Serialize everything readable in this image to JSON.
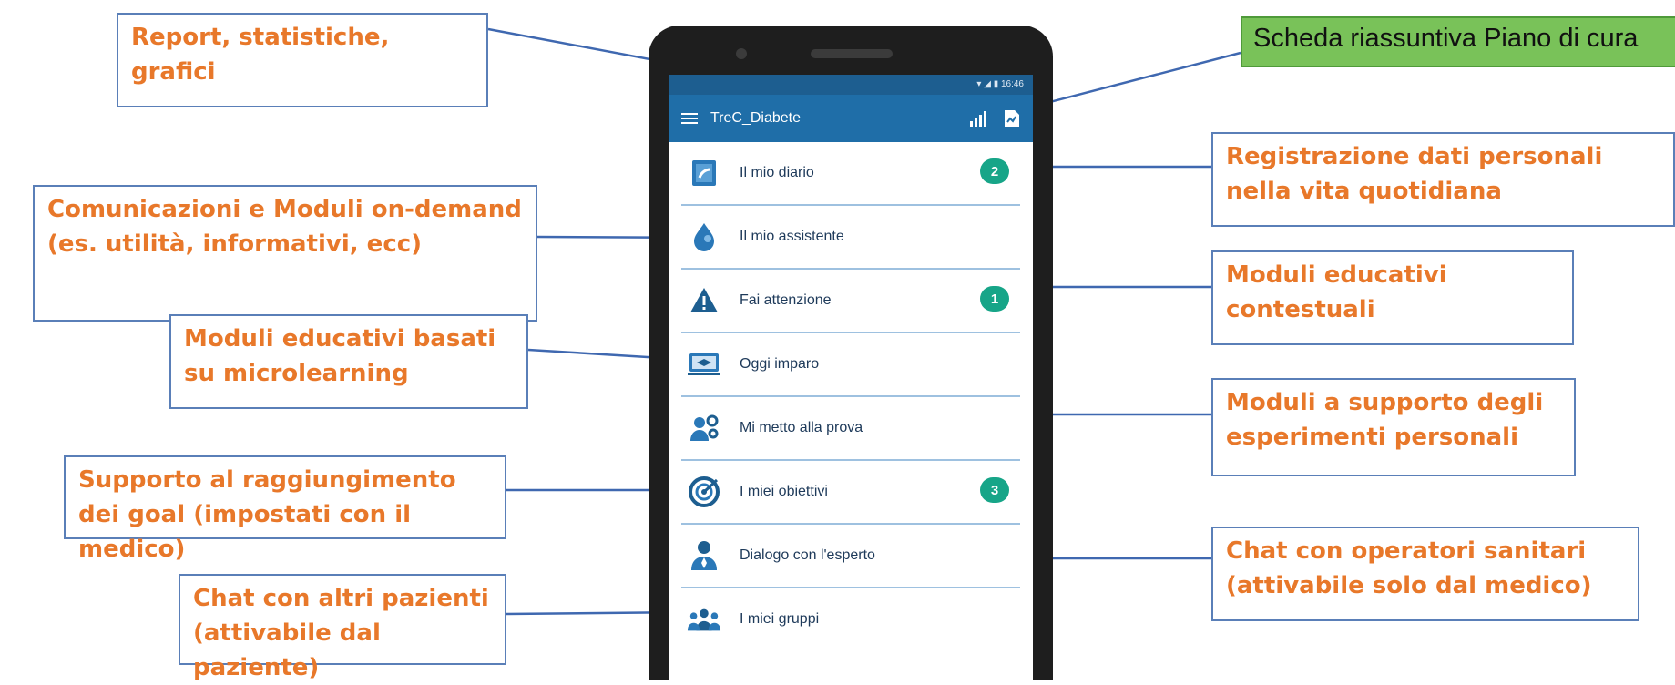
{
  "app": {
    "status": "▾ ◢ ▮ 16:46",
    "title": "TreC_Diabete"
  },
  "menu": [
    {
      "label": "Il mio diario",
      "badge": "2",
      "icon": "diary-icon"
    },
    {
      "label": "Il mio assistente",
      "badge": "",
      "icon": "drop-icon"
    },
    {
      "label": "Fai attenzione",
      "badge": "1",
      "icon": "warning-icon"
    },
    {
      "label": "Oggi imparo",
      "badge": "",
      "icon": "learning-icon"
    },
    {
      "label": "Mi metto alla prova",
      "badge": "",
      "icon": "test-icon"
    },
    {
      "label": "I miei obiettivi",
      "badge": "3",
      "icon": "target-icon"
    },
    {
      "label": "Dialogo con l'esperto",
      "badge": "",
      "icon": "expert-icon"
    },
    {
      "label": "I miei gruppi",
      "badge": "",
      "icon": "group-icon"
    }
  ],
  "callouts": {
    "report": "Report, statistiche, grafici",
    "summary": "Scheda riassuntiva Piano di cura",
    "comms": "Comunicazioni e Moduli on-demand (es. utilità, informativi, ecc)",
    "micro": "Moduli educativi basati su microlearning",
    "goals": "Supporto al raggiungimento dei goal (impostati con il medico)",
    "chat_patients": "Chat con altri pazienti (attivabile dal paziente)",
    "registration": "Registrazione dati personali nella vita quotidiana",
    "contextual": "Moduli educativi contestuali",
    "experiments": "Moduli a supporto degli esperimenti personali",
    "chat_operators": "Chat con operatori sanitari (attivabile solo dal medico)"
  },
  "colors": {
    "appbar": "#1f6ea8",
    "badge": "#17a588",
    "callout_text": "#e8782a",
    "summary_bg": "#79c259"
  }
}
